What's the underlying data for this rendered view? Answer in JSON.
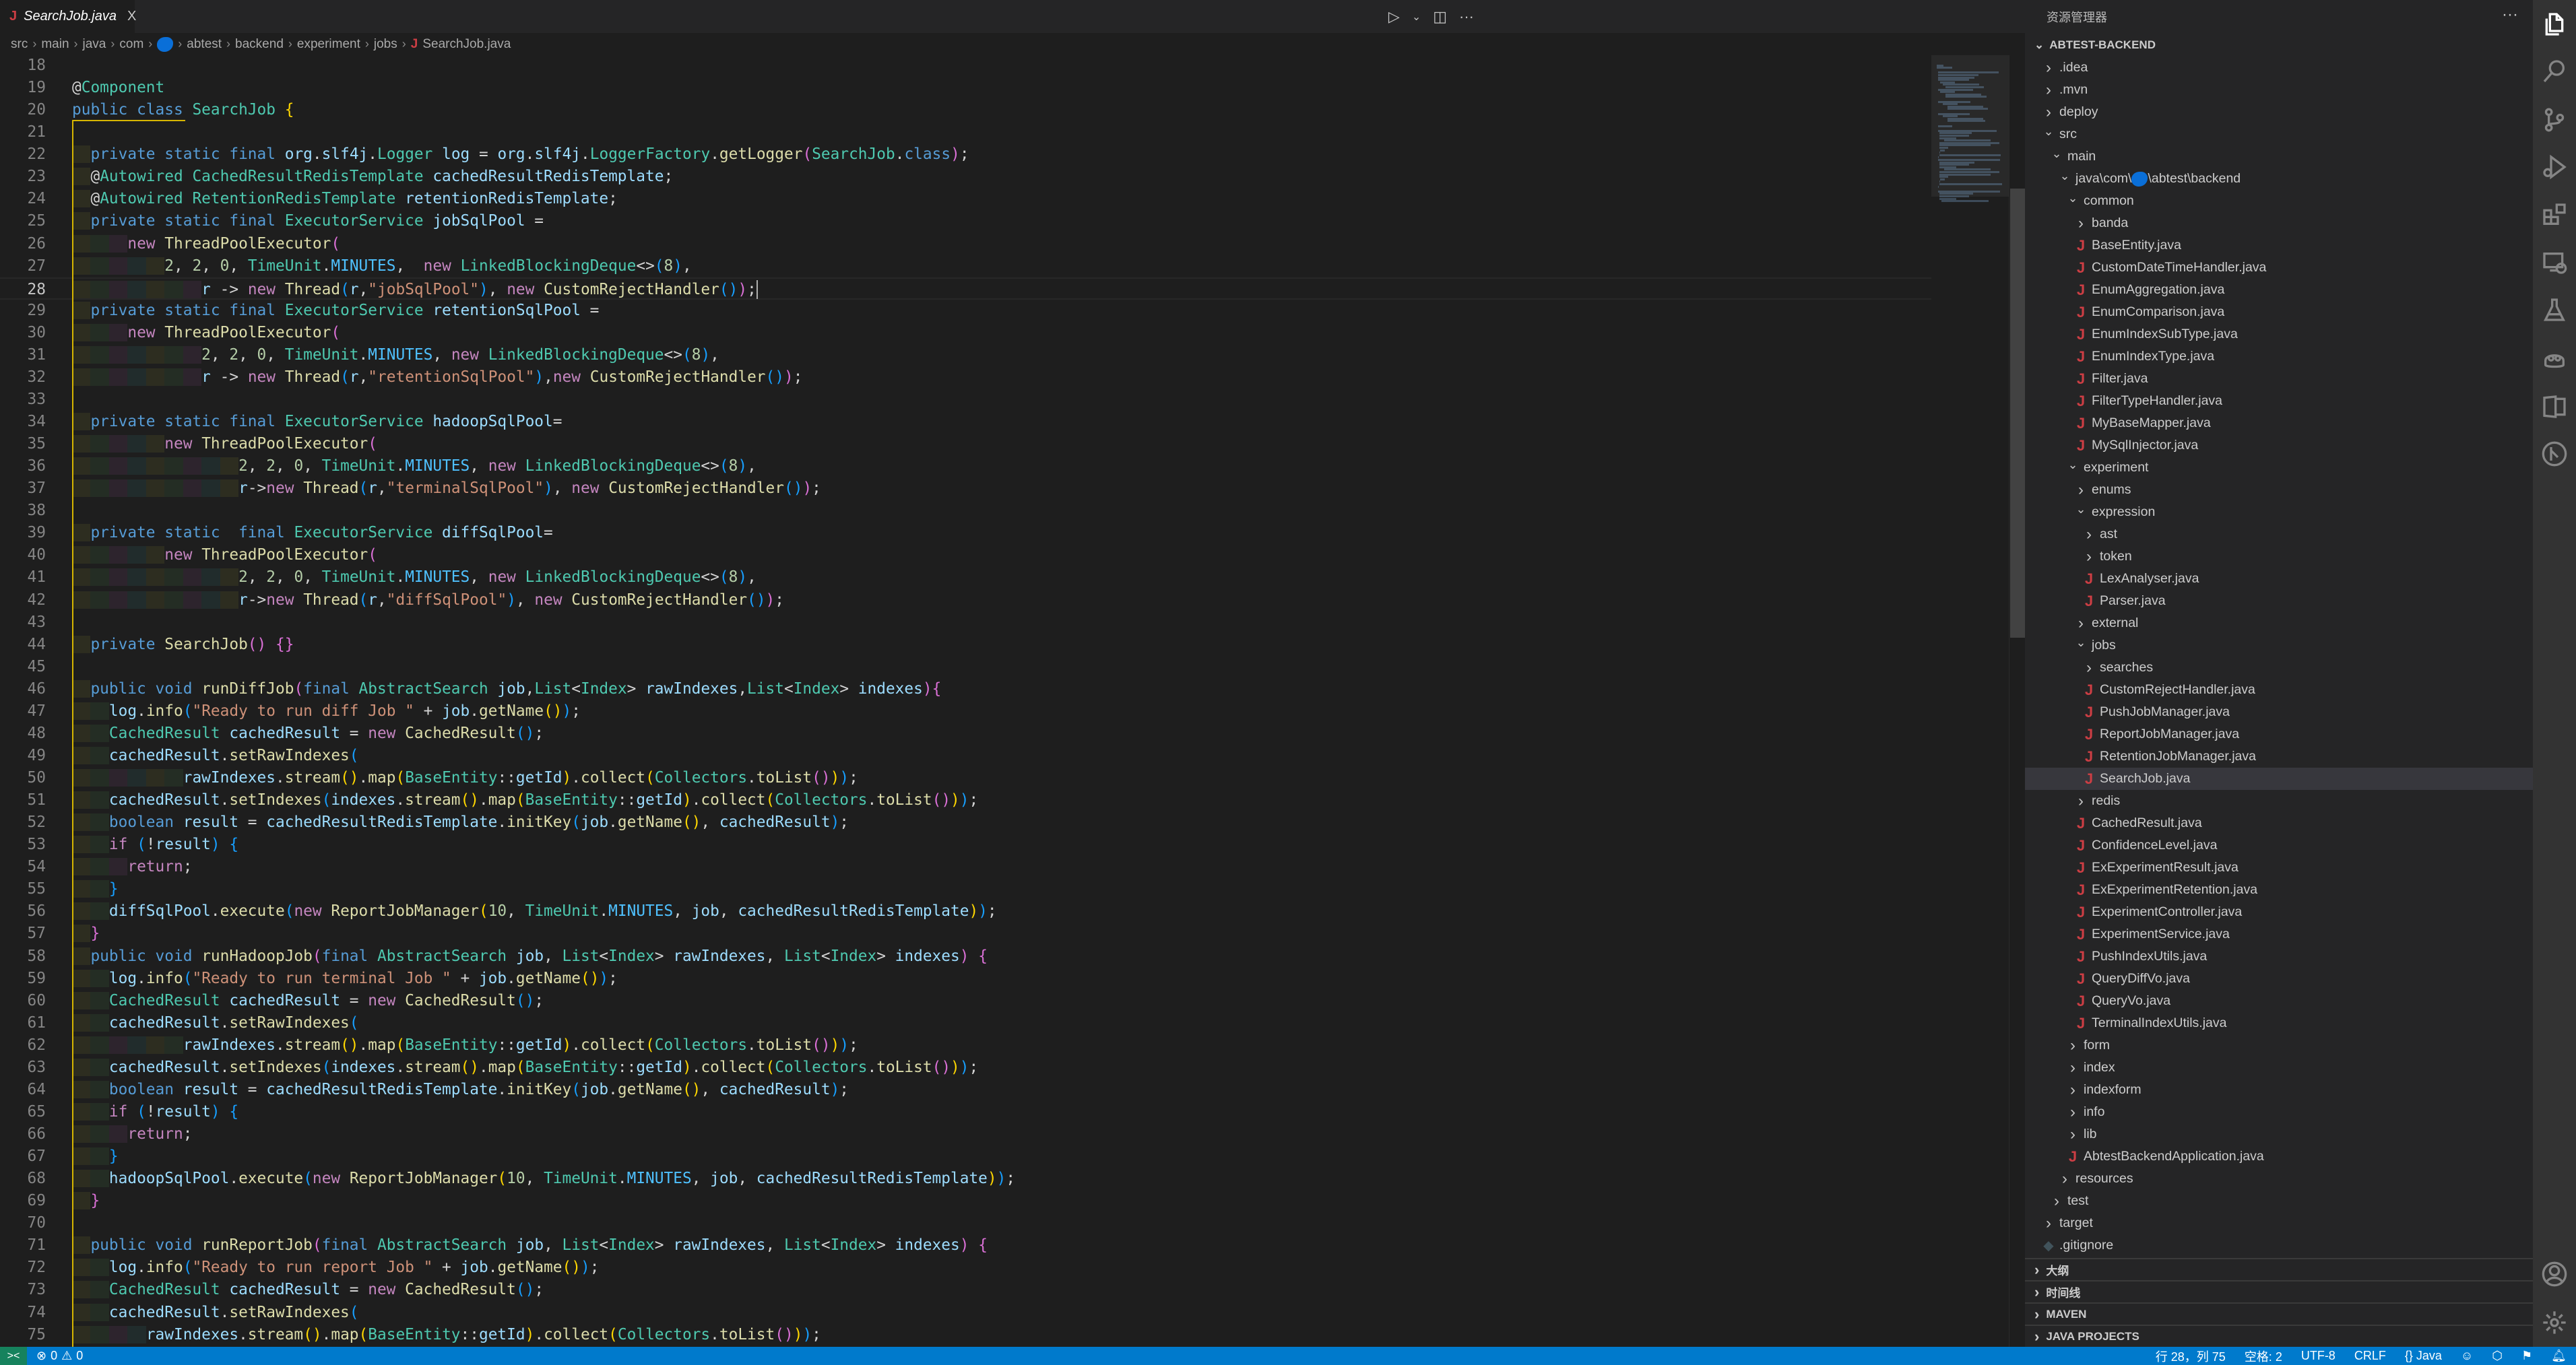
{
  "tab": {
    "label": "SearchJob.java",
    "icon": "java-icon",
    "close": "X"
  },
  "editor_actions": {
    "run": "▷",
    "run_menu": "⌄",
    "split": "◫",
    "more": "···"
  },
  "breadcrumb": [
    {
      "label": "src"
    },
    {
      "label": "main"
    },
    {
      "label": "java"
    },
    {
      "label": "com"
    },
    {
      "label": "",
      "redacted": true
    },
    {
      "label": "abtest"
    },
    {
      "label": "backend"
    },
    {
      "label": "experiment"
    },
    {
      "label": "jobs"
    },
    {
      "label": "SearchJob.java",
      "icon": "java-icon"
    }
  ],
  "editor": {
    "current_line": 28,
    "lines": [
      {
        "n": "18",
        "code": ""
      },
      {
        "n": "19",
        "code": "@Component"
      },
      {
        "n": "20",
        "code": "public class SearchJob {"
      },
      {
        "n": "21",
        "code": ""
      },
      {
        "n": "22",
        "code": "  private static final org.slf4j.Logger log = org.slf4j.LoggerFactory.getLogger(SearchJob.class);"
      },
      {
        "n": "23",
        "code": "  @Autowired CachedResultRedisTemplate cachedResultRedisTemplate;"
      },
      {
        "n": "24",
        "code": "  @Autowired RetentionRedisTemplate retentionRedisTemplate;"
      },
      {
        "n": "25",
        "code": "  private static final ExecutorService jobSqlPool ="
      },
      {
        "n": "26",
        "code": "      new ThreadPoolExecutor("
      },
      {
        "n": "27",
        "code": "          2, 2, 0, TimeUnit.MINUTES,  new LinkedBlockingDeque<>(8),"
      },
      {
        "n": "28",
        "code": "              r -> new Thread(r,\"jobSqlPool\"), new CustomRejectHandler());"
      },
      {
        "n": "29",
        "code": "  private static final ExecutorService retentionSqlPool ="
      },
      {
        "n": "30",
        "code": "      new ThreadPoolExecutor("
      },
      {
        "n": "31",
        "code": "              2, 2, 0, TimeUnit.MINUTES, new LinkedBlockingDeque<>(8),"
      },
      {
        "n": "32",
        "code": "              r -> new Thread(r,\"retentionSqlPool\"),new CustomRejectHandler());"
      },
      {
        "n": "33",
        "code": ""
      },
      {
        "n": "34",
        "code": "  private static final ExecutorService hadoopSqlPool="
      },
      {
        "n": "35",
        "code": "          new ThreadPoolExecutor("
      },
      {
        "n": "36",
        "code": "                  2, 2, 0, TimeUnit.MINUTES, new LinkedBlockingDeque<>(8),"
      },
      {
        "n": "37",
        "code": "                  r->new Thread(r,\"terminalSqlPool\"), new CustomRejectHandler());"
      },
      {
        "n": "38",
        "code": ""
      },
      {
        "n": "39",
        "code": "  private static  final ExecutorService diffSqlPool="
      },
      {
        "n": "40",
        "code": "          new ThreadPoolExecutor("
      },
      {
        "n": "41",
        "code": "                  2, 2, 0, TimeUnit.MINUTES, new LinkedBlockingDeque<>(8),"
      },
      {
        "n": "42",
        "code": "                  r->new Thread(r,\"diffSqlPool\"), new CustomRejectHandler());"
      },
      {
        "n": "43",
        "code": ""
      },
      {
        "n": "44",
        "code": "  private SearchJob() {}"
      },
      {
        "n": "45",
        "code": ""
      },
      {
        "n": "46",
        "code": "  public void runDiffJob(final AbstractSearch job,List<Index> rawIndexes,List<Index> indexes){"
      },
      {
        "n": "47",
        "code": "    log.info(\"Ready to run diff Job \" + job.getName());"
      },
      {
        "n": "48",
        "code": "    CachedResult cachedResult = new CachedResult();"
      },
      {
        "n": "49",
        "code": "    cachedResult.setRawIndexes("
      },
      {
        "n": "50",
        "code": "            rawIndexes.stream().map(BaseEntity::getId).collect(Collectors.toList()));"
      },
      {
        "n": "51",
        "code": "    cachedResult.setIndexes(indexes.stream().map(BaseEntity::getId).collect(Collectors.toList()));"
      },
      {
        "n": "52",
        "code": "    boolean result = cachedResultRedisTemplate.initKey(job.getName(), cachedResult);"
      },
      {
        "n": "53",
        "code": "    if (!result) {"
      },
      {
        "n": "54",
        "code": "      return;"
      },
      {
        "n": "55",
        "code": "    }"
      },
      {
        "n": "56",
        "code": "    diffSqlPool.execute(new ReportJobManager(10, TimeUnit.MINUTES, job, cachedResultRedisTemplate));"
      },
      {
        "n": "57",
        "code": "  }"
      },
      {
        "n": "58",
        "code": "  public void runHadoopJob(final AbstractSearch job, List<Index> rawIndexes, List<Index> indexes) {"
      },
      {
        "n": "59",
        "code": "    log.info(\"Ready to run terminal Job \" + job.getName());"
      },
      {
        "n": "60",
        "code": "    CachedResult cachedResult = new CachedResult();"
      },
      {
        "n": "61",
        "code": "    cachedResult.setRawIndexes("
      },
      {
        "n": "62",
        "code": "            rawIndexes.stream().map(BaseEntity::getId).collect(Collectors.toList()));"
      },
      {
        "n": "63",
        "code": "    cachedResult.setIndexes(indexes.stream().map(BaseEntity::getId).collect(Collectors.toList()));"
      },
      {
        "n": "64",
        "code": "    boolean result = cachedResultRedisTemplate.initKey(job.getName(), cachedResult);"
      },
      {
        "n": "65",
        "code": "    if (!result) {"
      },
      {
        "n": "66",
        "code": "      return;"
      },
      {
        "n": "67",
        "code": "    }"
      },
      {
        "n": "68",
        "code": "    hadoopSqlPool.execute(new ReportJobManager(10, TimeUnit.MINUTES, job, cachedResultRedisTemplate));"
      },
      {
        "n": "69",
        "code": "  }"
      },
      {
        "n": "70",
        "code": ""
      },
      {
        "n": "71",
        "code": "  public void runReportJob(final AbstractSearch job, List<Index> rawIndexes, List<Index> indexes) {"
      },
      {
        "n": "72",
        "code": "    log.info(\"Ready to run report Job \" + job.getName());"
      },
      {
        "n": "73",
        "code": "    CachedResult cachedResult = new CachedResult();"
      },
      {
        "n": "74",
        "code": "    cachedResult.setRawIndexes("
      },
      {
        "n": "75",
        "code": "        rawIndexes.stream().map(BaseEntity::getId).collect(Collectors.toList()));"
      }
    ]
  },
  "sidebar": {
    "title": "资源管理器",
    "more": "···",
    "root": "ABTEST-BACKEND",
    "tree": [
      {
        "label": ".idea",
        "level": 0,
        "type": "folder-closed"
      },
      {
        "label": ".mvn",
        "level": 0,
        "type": "folder-closed"
      },
      {
        "label": "deploy",
        "level": 0,
        "type": "folder-closed"
      },
      {
        "label": "src",
        "level": 0,
        "type": "folder-open"
      },
      {
        "label": "main",
        "level": 1,
        "type": "folder-open"
      },
      {
        "label": "java\\com\\",
        "label_after": "\\abtest\\backend",
        "redacted": true,
        "level": 2,
        "type": "folder-open"
      },
      {
        "label": "common",
        "level": 3,
        "type": "folder-open"
      },
      {
        "label": "banda",
        "level": 4,
        "type": "folder-closed"
      },
      {
        "label": "BaseEntity.java",
        "level": 4,
        "type": "java"
      },
      {
        "label": "CustomDateTimeHandler.java",
        "level": 4,
        "type": "java"
      },
      {
        "label": "EnumAggregation.java",
        "level": 4,
        "type": "java"
      },
      {
        "label": "EnumComparison.java",
        "level": 4,
        "type": "java"
      },
      {
        "label": "EnumIndexSubType.java",
        "level": 4,
        "type": "java"
      },
      {
        "label": "EnumIndexType.java",
        "level": 4,
        "type": "java"
      },
      {
        "label": "Filter.java",
        "level": 4,
        "type": "java"
      },
      {
        "label": "FilterTypeHandler.java",
        "level": 4,
        "type": "java"
      },
      {
        "label": "MyBaseMapper.java",
        "level": 4,
        "type": "java"
      },
      {
        "label": "MySqlInjector.java",
        "level": 4,
        "type": "java"
      },
      {
        "label": "experiment",
        "level": 3,
        "type": "folder-open"
      },
      {
        "label": "enums",
        "level": 4,
        "type": "folder-closed"
      },
      {
        "label": "expression",
        "level": 4,
        "type": "folder-open"
      },
      {
        "label": "ast",
        "level": 5,
        "type": "folder-closed"
      },
      {
        "label": "token",
        "level": 5,
        "type": "folder-closed"
      },
      {
        "label": "LexAnalyser.java",
        "level": 5,
        "type": "java"
      },
      {
        "label": "Parser.java",
        "level": 5,
        "type": "java"
      },
      {
        "label": "external",
        "level": 4,
        "type": "folder-closed"
      },
      {
        "label": "jobs",
        "level": 4,
        "type": "folder-open"
      },
      {
        "label": "searches",
        "level": 5,
        "type": "folder-closed"
      },
      {
        "label": "CustomRejectHandler.java",
        "level": 5,
        "type": "java"
      },
      {
        "label": "PushJobManager.java",
        "level": 5,
        "type": "java"
      },
      {
        "label": "ReportJobManager.java",
        "level": 5,
        "type": "java"
      },
      {
        "label": "RetentionJobManager.java",
        "level": 5,
        "type": "java"
      },
      {
        "label": "SearchJob.java",
        "level": 5,
        "type": "java",
        "selected": true
      },
      {
        "label": "redis",
        "level": 4,
        "type": "folder-closed"
      },
      {
        "label": "CachedResult.java",
        "level": 4,
        "type": "java"
      },
      {
        "label": "ConfidenceLevel.java",
        "level": 4,
        "type": "java"
      },
      {
        "label": "ExExperimentResult.java",
        "level": 4,
        "type": "java"
      },
      {
        "label": "ExExperimentRetention.java",
        "level": 4,
        "type": "java"
      },
      {
        "label": "ExperimentController.java",
        "level": 4,
        "type": "java"
      },
      {
        "label": "ExperimentService.java",
        "level": 4,
        "type": "java"
      },
      {
        "label": "PushIndexUtils.java",
        "level": 4,
        "type": "java"
      },
      {
        "label": "QueryDiffVo.java",
        "level": 4,
        "type": "java"
      },
      {
        "label": "QueryVo.java",
        "level": 4,
        "type": "java"
      },
      {
        "label": "TerminalIndexUtils.java",
        "level": 4,
        "type": "java"
      },
      {
        "label": "form",
        "level": 3,
        "type": "folder-closed"
      },
      {
        "label": "index",
        "level": 3,
        "type": "folder-closed"
      },
      {
        "label": "indexform",
        "level": 3,
        "type": "folder-closed"
      },
      {
        "label": "info",
        "level": 3,
        "type": "folder-closed"
      },
      {
        "label": "lib",
        "level": 3,
        "type": "folder-closed"
      },
      {
        "label": "AbtestBackendApplication.java",
        "level": 3,
        "type": "java"
      },
      {
        "label": "resources",
        "level": 2,
        "type": "folder-closed"
      },
      {
        "label": "test",
        "level": 1,
        "type": "folder-closed"
      },
      {
        "label": "target",
        "level": 0,
        "type": "folder-closed"
      },
      {
        "label": ".gitignore",
        "level": 0,
        "type": "gitignore"
      }
    ],
    "sections": [
      {
        "label": "大纲"
      },
      {
        "label": "时间线"
      },
      {
        "label": "MAVEN"
      },
      {
        "label": "JAVA PROJECTS"
      }
    ]
  },
  "activity_bar": [
    "explorer-icon",
    "search-icon",
    "source-control-icon",
    "run-debug-icon",
    "extensions-icon",
    "remote-explorer-icon",
    "testing-icon",
    "copilot-icon",
    "sql-icon",
    "git-graph-icon",
    "account-icon",
    "settings-icon"
  ],
  "status": {
    "remote": "><",
    "errors": "0",
    "warnings": "0",
    "position": "行 28，列 75",
    "indent": "空格: 2",
    "encoding": "UTF-8",
    "eol": "CRLF",
    "language": "{} Java"
  },
  "colors": {
    "accent": "#007acc",
    "remote": "#16825d",
    "java_icon": "#cc3e44",
    "selection": "#37373d",
    "bracket_1": "#ffd700",
    "bracket_2": "#da70d6",
    "bracket_3": "#179fff"
  }
}
